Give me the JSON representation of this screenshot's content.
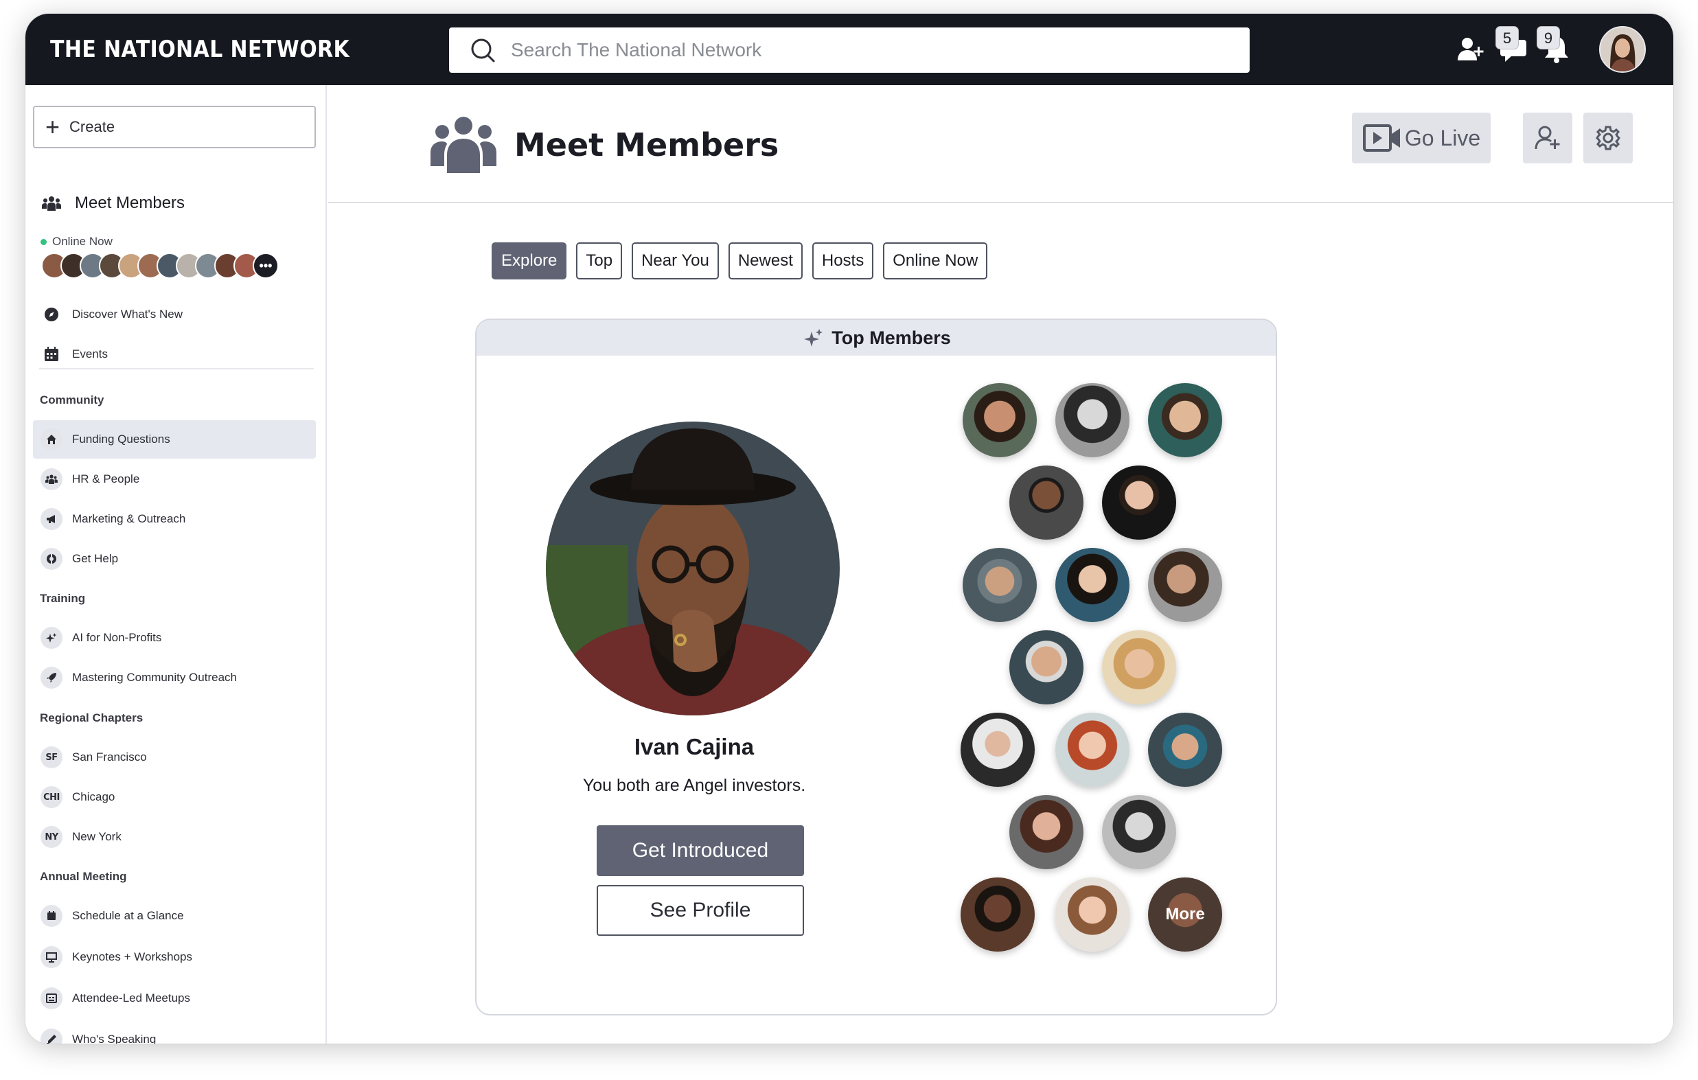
{
  "app": {
    "brand": "THE NATIONAL NETWORK",
    "search_placeholder": "Search The National Network",
    "chat_badge": "5",
    "notification_badge": "9"
  },
  "sidebar": {
    "create_label": "Create",
    "meet_members": "Meet Members",
    "online_now": "Online Now",
    "top_links": [
      {
        "label": "Discover What's New",
        "icon": "compass-icon"
      },
      {
        "label": "Events",
        "icon": "calendar-icon"
      }
    ],
    "sections": [
      {
        "title": "Community",
        "items": [
          {
            "label": "Funding Questions",
            "icon": "home-icon",
            "active": true
          },
          {
            "label": "HR & People",
            "icon": "people-icon"
          },
          {
            "label": "Marketing & Outreach",
            "icon": "megaphone-icon"
          },
          {
            "label": "Get Help",
            "icon": "help-icon"
          }
        ]
      },
      {
        "title": "Training",
        "items": [
          {
            "label": "AI for Non-Profits",
            "icon": "sparkle-icon"
          },
          {
            "label": "Mastering Community Outreach",
            "icon": "rocket-icon"
          }
        ]
      },
      {
        "title": "Regional Chapters",
        "items": [
          {
            "label": "San Francisco",
            "abbr": "SF"
          },
          {
            "label": "Chicago",
            "abbr": "CHI"
          },
          {
            "label": "New York",
            "abbr": "NY"
          }
        ]
      },
      {
        "title": "Annual Meeting",
        "items": [
          {
            "label": "Schedule at a Glance",
            "icon": "calendar-icon"
          },
          {
            "label": "Keynotes + Workshops",
            "icon": "presentation-icon"
          },
          {
            "label": "Attendee-Led Meetups",
            "icon": "meetup-icon"
          },
          {
            "label": "Who's Speaking",
            "icon": "microphone-icon"
          }
        ]
      }
    ]
  },
  "main": {
    "title": "Meet Members",
    "go_live": "Go Live",
    "tabs": [
      "Explore",
      "Top",
      "Near You",
      "Newest",
      "Hosts",
      "Online Now"
    ],
    "active_tab": "Explore",
    "card": {
      "title": "Top Members",
      "featured": {
        "name": "Ivan Cajina",
        "subtitle": "You both are Angel investors."
      },
      "get_introduced": "Get Introduced",
      "see_profile": "See Profile",
      "more_label": "More"
    }
  },
  "colors": {
    "topbar": "#16181f",
    "accent": "#5f6373",
    "online": "#33c27f",
    "active_nav": "#e6e8f0"
  }
}
